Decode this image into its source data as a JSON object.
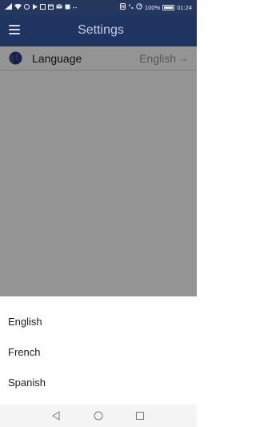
{
  "status_bar": {
    "battery_percent": "100%",
    "time": "01:24"
  },
  "app_bar": {
    "title": "Settings",
    "menu_icon": "hamburger-menu-icon"
  },
  "settings": {
    "language_row": {
      "icon": "globe-icon",
      "label": "Language",
      "value": "English",
      "arrow_icon": "arrow-right-icon",
      "arrow": "→"
    }
  },
  "language_sheet": {
    "options": [
      {
        "label": "English"
      },
      {
        "label": "French"
      },
      {
        "label": "Spanish"
      }
    ]
  },
  "nav_bar": {
    "back_icon": "back-triangle-icon",
    "home_icon": "home-circle-icon",
    "recents_icon": "recents-square-icon"
  }
}
